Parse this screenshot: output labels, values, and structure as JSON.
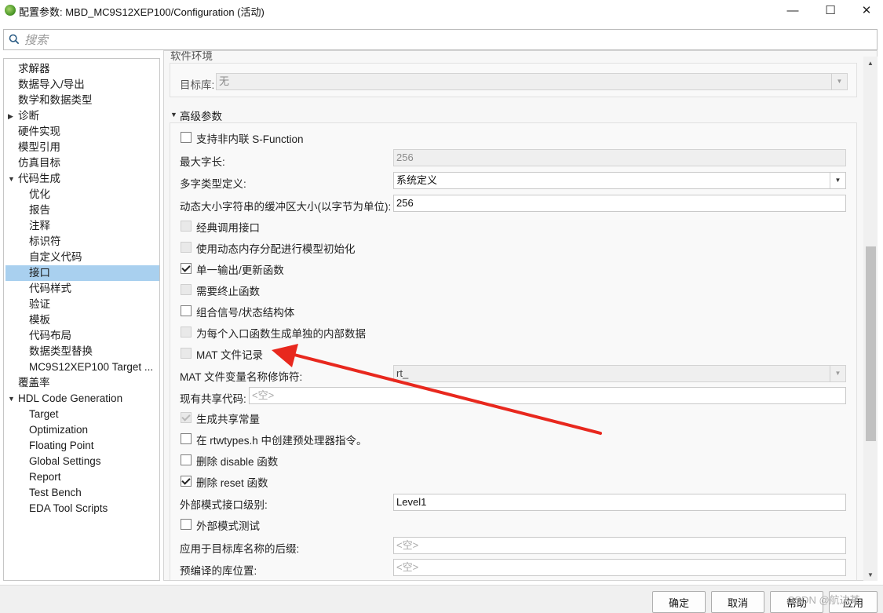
{
  "window": {
    "title": "配置参数: MBD_MC9S12XEP100/Configuration (活动)",
    "minimize_glyph": "—",
    "maximize_glyph": "☐",
    "close_glyph": "✕"
  },
  "search": {
    "placeholder": "搜索",
    "value": ""
  },
  "tree": {
    "items": [
      {
        "label": "求解器",
        "level": 0,
        "caret": ""
      },
      {
        "label": "数据导入/导出",
        "level": 0,
        "caret": ""
      },
      {
        "label": "数学和数据类型",
        "level": 0,
        "caret": ""
      },
      {
        "label": "诊断",
        "level": 0,
        "caret": "collapsed"
      },
      {
        "label": "硬件实现",
        "level": 0,
        "caret": ""
      },
      {
        "label": "模型引用",
        "level": 0,
        "caret": ""
      },
      {
        "label": "仿真目标",
        "level": 0,
        "caret": ""
      },
      {
        "label": "代码生成",
        "level": 0,
        "caret": "expanded"
      },
      {
        "label": "优化",
        "level": 1,
        "caret": ""
      },
      {
        "label": "报告",
        "level": 1,
        "caret": ""
      },
      {
        "label": "注释",
        "level": 1,
        "caret": ""
      },
      {
        "label": "标识符",
        "level": 1,
        "caret": ""
      },
      {
        "label": "自定义代码",
        "level": 1,
        "caret": ""
      },
      {
        "label": "接口",
        "level": 1,
        "caret": "",
        "selected": true
      },
      {
        "label": "代码样式",
        "level": 1,
        "caret": ""
      },
      {
        "label": "验证",
        "level": 1,
        "caret": ""
      },
      {
        "label": "模板",
        "level": 1,
        "caret": ""
      },
      {
        "label": "代码布局",
        "level": 1,
        "caret": ""
      },
      {
        "label": "数据类型替换",
        "level": 1,
        "caret": ""
      },
      {
        "label": "MC9S12XEP100 Target ...",
        "level": 1,
        "caret": ""
      },
      {
        "label": "覆盖率",
        "level": 0,
        "caret": ""
      },
      {
        "label": "HDL Code Generation",
        "level": 0,
        "caret": "expanded"
      },
      {
        "label": "Target",
        "level": 1,
        "caret": ""
      },
      {
        "label": "Optimization",
        "level": 1,
        "caret": ""
      },
      {
        "label": "Floating Point",
        "level": 1,
        "caret": ""
      },
      {
        "label": "Global Settings",
        "level": 1,
        "caret": ""
      },
      {
        "label": "Report",
        "level": 1,
        "caret": ""
      },
      {
        "label": "Test Bench",
        "level": 1,
        "caret": ""
      },
      {
        "label": "EDA Tool Scripts",
        "level": 1,
        "caret": ""
      }
    ]
  },
  "content": {
    "partial_heading": "软件环境",
    "target_lib": {
      "label": "目标库:",
      "value": "无"
    },
    "advanced_heading": "高级参数",
    "caret_expanded": "▼",
    "rows": {
      "sfunction": {
        "label": "支持非内联 S-Function",
        "checked": false,
        "disabled": false
      },
      "max_id_len": {
        "label": "最大字长:",
        "value": "256"
      },
      "multiword_def": {
        "label": "多字类型定义:",
        "value": "系统定义"
      },
      "dyn_buffer": {
        "label": "动态大小字符串的缓冲区大小(以字节为单位):",
        "value": "256"
      },
      "classic_iface": {
        "label": "经典调用接口",
        "checked": false,
        "disabled": true
      },
      "dyn_mem_init": {
        "label": "使用动态内存分配进行模型初始化",
        "checked": false,
        "disabled": true
      },
      "single_output": {
        "label": "单一输出/更新函数",
        "checked": true,
        "disabled": false
      },
      "terminate_fn": {
        "label": "需要终止函数",
        "checked": false,
        "disabled": true
      },
      "combine_signals": {
        "label": "组合信号/状态结构体",
        "checked": false,
        "disabled": false
      },
      "per_entry_data": {
        "label": "为每个入口函数生成单独的内部数据",
        "checked": false,
        "disabled": true
      },
      "mat_logging": {
        "label": "MAT 文件记录",
        "checked": false,
        "disabled": true
      },
      "mat_modifier": {
        "label": "MAT 文件变量名称修饰符:",
        "value": "rt_"
      },
      "shared_code": {
        "label": "现有共享代码:",
        "placeholder": "<空>"
      },
      "shared_consts": {
        "label": "生成共享常量",
        "checked": true,
        "disabled": true
      },
      "rtwtypes": {
        "label": "在 rtwtypes.h 中创建预处理器指令。",
        "checked": false,
        "disabled": false
      },
      "remove_disable": {
        "label": "删除 disable 函数",
        "checked": false,
        "disabled": false
      },
      "remove_reset": {
        "label": "删除 reset 函数",
        "checked": true,
        "disabled": false
      },
      "ext_mode_level": {
        "label": "外部模式接口级别:",
        "value": "Level1"
      },
      "ext_mode_test": {
        "label": "外部模式测试",
        "checked": false,
        "disabled": false
      },
      "lib_suffix": {
        "label": "应用于目标库名称的后缀:",
        "placeholder": "<空>"
      },
      "precomp_lib": {
        "label": "预编译的库位置:",
        "placeholder": "<空>"
      }
    }
  },
  "buttons": {
    "ok": "确定",
    "cancel": "取消",
    "help": "帮助",
    "apply": "应用"
  },
  "watermark": "CSDN @航达某",
  "colors": {
    "selection": "#a9d0ef",
    "arrow": "#e8281e"
  }
}
